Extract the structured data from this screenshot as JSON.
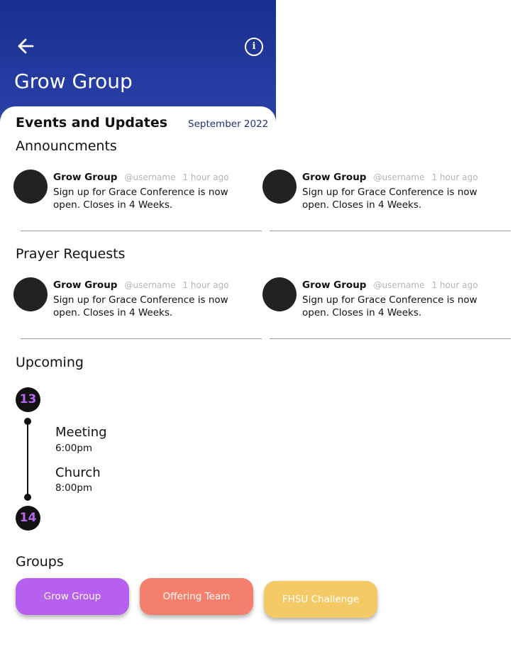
{
  "header": {
    "title": "Grow Group",
    "back_icon": "arrow-left-icon",
    "info_icon": "info-icon",
    "info_glyph": "i"
  },
  "events": {
    "title": "Events and Updates",
    "month": "September 2022"
  },
  "announcements": {
    "title": "Announcments",
    "posts": [
      {
        "author": "Grow Group",
        "username": "@username",
        "time": "1 hour ago",
        "text": "Sign up for Grace Conference is now open. Closes in 4 Weeks."
      },
      {
        "author": "Grow Group",
        "username": "@username",
        "time": "1 hour ago",
        "text": "Sign up for Grace Conference is now open. Closes in 4 Weeks."
      }
    ]
  },
  "prayer": {
    "title": "Prayer Requests",
    "posts": [
      {
        "author": "Grow Group",
        "username": "@username",
        "time": "1 hour ago",
        "text": "Sign up for Grace Conference is now open. Closes in 4 Weeks."
      },
      {
        "author": "Grow Group",
        "username": "@username",
        "time": "1 hour ago",
        "text": "Sign up for Grace Conference is now open. Closes in 4 Weeks."
      }
    ]
  },
  "upcoming": {
    "title": "Upcoming",
    "days": [
      "13",
      "14"
    ],
    "events": [
      {
        "name": "Meeting",
        "time": "6:00pm"
      },
      {
        "name": "Church",
        "time": "8:00pm"
      }
    ]
  },
  "groups": {
    "title": "Groups",
    "items": [
      {
        "label": "Grow Group",
        "color": "#b760f0"
      },
      {
        "label": "Offering Team",
        "color": "#f47f6c"
      },
      {
        "label": "FHSU Challenge",
        "color": "#f4ca66"
      }
    ]
  },
  "colors": {
    "header_top": "#182f8e",
    "header_bottom": "#2d43a9",
    "day_number": "#b566ef",
    "month": "#1f3476"
  }
}
